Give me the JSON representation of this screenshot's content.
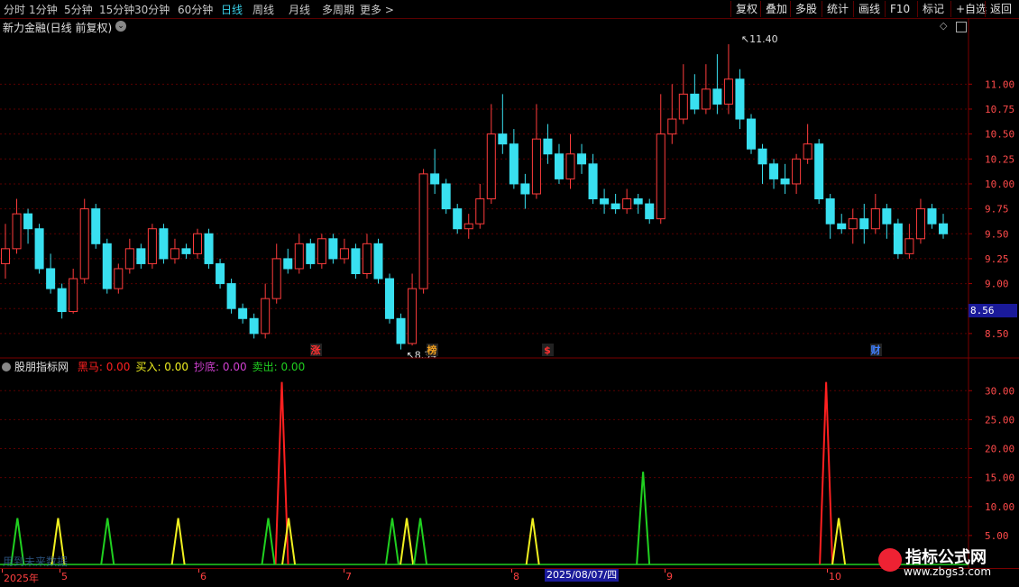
{
  "toolbar": {
    "periods": [
      "分时",
      "1分钟",
      "5分钟",
      "15分钟",
      "30分钟",
      "60分钟",
      "日线",
      "周线",
      "月线",
      "多周期",
      "更多 >"
    ],
    "active_period": "日线",
    "tools": [
      "复权",
      "叠加",
      "多股",
      "统计",
      "画线",
      "F10",
      "标记",
      "+自选",
      "返回"
    ]
  },
  "main": {
    "title": "新力金融(日线 前复权)",
    "high_marker": "11.40",
    "low_marker": "8.34",
    "current_price": "8.56",
    "y_ticks": [
      "11.00",
      "10.75",
      "10.50",
      "10.25",
      "10.00",
      "9.75",
      "9.50",
      "9.25",
      "9.00",
      "8.75",
      "8.50"
    ],
    "event_marks": [
      {
        "text": "涨",
        "color": "#ff3030"
      },
      {
        "text": "榜",
        "color": "#f0a020"
      },
      {
        "text": "$",
        "color": "#ff3030"
      },
      {
        "text": "财",
        "color": "#4080ff"
      }
    ],
    "colors": {
      "up": "#ff3c3c",
      "down": "#39e0f0",
      "grid": "#5a0000"
    }
  },
  "indicator": {
    "name": "股朋指标网",
    "items": [
      {
        "label": "黑马:",
        "value": "0.00",
        "color": "#ff2020"
      },
      {
        "label": "买入:",
        "value": "0.00",
        "color": "#f0f020"
      },
      {
        "label": "抄底:",
        "value": "0.00",
        "color": "#d040d0"
      },
      {
        "label": "卖出:",
        "value": "0.00",
        "color": "#20d020"
      }
    ],
    "y_ticks": [
      "30.00",
      "25.00",
      "20.00",
      "15.00",
      "10.00",
      "5.00"
    ],
    "bottom_text": "用到未来数据"
  },
  "xaxis": {
    "labels": [
      "2025年",
      "5",
      "6",
      "7",
      "8",
      "9",
      "10"
    ],
    "cursor_date": "2025/08/07/四"
  },
  "watermark": {
    "line1": "指标公式网",
    "line2": "www.zbgs3.com"
  },
  "chart_data": {
    "type": "candlestick",
    "title": "新力金融(日线 前复权)",
    "ylim": [
      8.3,
      11.5
    ],
    "high": 11.4,
    "low": 8.34,
    "last": 8.56,
    "candles": [
      [
        9.2,
        9.35,
        9.6,
        9.05
      ],
      [
        9.35,
        9.7,
        9.85,
        9.3
      ],
      [
        9.7,
        9.55,
        9.75,
        9.4
      ],
      [
        9.55,
        9.15,
        9.6,
        9.1
      ],
      [
        9.15,
        8.95,
        9.3,
        8.9
      ],
      [
        8.95,
        8.72,
        9.0,
        8.65
      ],
      [
        8.72,
        9.05,
        9.15,
        8.7
      ],
      [
        9.05,
        9.75,
        9.85,
        9.0
      ],
      [
        9.75,
        9.4,
        9.8,
        9.35
      ],
      [
        9.4,
        8.95,
        9.45,
        8.9
      ],
      [
        8.95,
        9.15,
        9.2,
        8.9
      ],
      [
        9.15,
        9.35,
        9.45,
        9.1
      ],
      [
        9.35,
        9.2,
        9.4,
        9.15
      ],
      [
        9.2,
        9.55,
        9.6,
        9.15
      ],
      [
        9.55,
        9.25,
        9.6,
        9.2
      ],
      [
        9.25,
        9.35,
        9.45,
        9.2
      ],
      [
        9.35,
        9.3,
        9.4,
        9.25
      ],
      [
        9.3,
        9.5,
        9.55,
        9.25
      ],
      [
        9.5,
        9.2,
        9.55,
        9.15
      ],
      [
        9.2,
        9.0,
        9.25,
        8.95
      ],
      [
        9.0,
        8.75,
        9.05,
        8.7
      ],
      [
        8.75,
        8.65,
        8.8,
        8.6
      ],
      [
        8.65,
        8.5,
        8.7,
        8.45
      ],
      [
        8.5,
        8.85,
        9.0,
        8.45
      ],
      [
        8.85,
        9.25,
        9.4,
        8.8
      ],
      [
        9.25,
        9.15,
        9.35,
        9.1
      ],
      [
        9.15,
        9.4,
        9.5,
        9.1
      ],
      [
        9.4,
        9.2,
        9.45,
        9.15
      ],
      [
        9.2,
        9.45,
        9.5,
        9.15
      ],
      [
        9.45,
        9.25,
        9.5,
        9.2
      ],
      [
        9.25,
        9.35,
        9.45,
        9.2
      ],
      [
        9.35,
        9.1,
        9.4,
        9.05
      ],
      [
        9.1,
        9.4,
        9.5,
        9.05
      ],
      [
        9.4,
        9.05,
        9.45,
        9.0
      ],
      [
        9.05,
        8.65,
        9.1,
        8.6
      ],
      [
        8.65,
        8.4,
        8.7,
        8.34
      ],
      [
        8.4,
        8.95,
        9.1,
        8.38
      ],
      [
        8.95,
        10.1,
        10.15,
        8.9
      ],
      [
        10.1,
        10.0,
        10.35,
        9.9
      ],
      [
        10.0,
        9.75,
        10.05,
        9.7
      ],
      [
        9.75,
        9.55,
        9.8,
        9.5
      ],
      [
        9.55,
        9.6,
        9.7,
        9.45
      ],
      [
        9.6,
        9.85,
        10.0,
        9.55
      ],
      [
        9.85,
        10.5,
        10.8,
        9.8
      ],
      [
        10.5,
        10.4,
        10.9,
        10.3
      ],
      [
        10.4,
        10.0,
        10.55,
        9.95
      ],
      [
        10.0,
        9.9,
        10.1,
        9.75
      ],
      [
        9.9,
        10.45,
        10.8,
        9.85
      ],
      [
        10.45,
        10.3,
        10.6,
        10.2
      ],
      [
        10.3,
        10.05,
        10.4,
        10.0
      ],
      [
        10.05,
        10.3,
        10.5,
        9.95
      ],
      [
        10.3,
        10.2,
        10.4,
        10.1
      ],
      [
        10.2,
        9.85,
        10.3,
        9.8
      ],
      [
        9.85,
        9.8,
        9.95,
        9.7
      ],
      [
        9.8,
        9.75,
        9.9,
        9.7
      ],
      [
        9.75,
        9.85,
        9.95,
        9.7
      ],
      [
        9.85,
        9.8,
        9.9,
        9.7
      ],
      [
        9.8,
        9.65,
        9.85,
        9.6
      ],
      [
        9.65,
        10.5,
        10.9,
        9.6
      ],
      [
        10.5,
        10.65,
        11.0,
        10.4
      ],
      [
        10.65,
        10.9,
        11.2,
        10.6
      ],
      [
        10.9,
        10.75,
        11.1,
        10.7
      ],
      [
        10.75,
        10.95,
        11.2,
        10.7
      ],
      [
        10.95,
        10.8,
        11.3,
        10.7
      ],
      [
        10.8,
        11.05,
        11.4,
        10.7
      ],
      [
        11.05,
        10.65,
        11.15,
        10.55
      ],
      [
        10.65,
        10.35,
        10.7,
        10.3
      ],
      [
        10.35,
        10.2,
        10.4,
        10.0
      ],
      [
        10.2,
        10.05,
        10.25,
        9.95
      ],
      [
        10.05,
        10.0,
        10.2,
        9.9
      ],
      [
        10.0,
        10.25,
        10.3,
        9.9
      ],
      [
        10.25,
        10.4,
        10.6,
        10.2
      ],
      [
        10.4,
        9.85,
        10.45,
        9.8
      ],
      [
        9.85,
        9.6,
        9.9,
        9.45
      ],
      [
        9.6,
        9.55,
        9.7,
        9.5
      ],
      [
        9.55,
        9.65,
        9.75,
        9.4
      ],
      [
        9.65,
        9.55,
        9.8,
        9.4
      ],
      [
        9.55,
        9.75,
        9.9,
        9.5
      ],
      [
        9.75,
        9.6,
        9.8,
        9.45
      ],
      [
        9.6,
        9.3,
        9.65,
        9.25
      ],
      [
        9.3,
        9.45,
        9.6,
        9.25
      ],
      [
        9.45,
        9.75,
        9.85,
        9.4
      ],
      [
        9.75,
        9.6,
        9.8,
        9.55
      ],
      [
        9.6,
        9.5,
        9.7,
        9.45
      ]
    ],
    "indicator_series": [
      {
        "name": "黑马",
        "color": "#ff2020",
        "spikes": [
          [
            0.291,
            31.5
          ],
          [
            0.853,
            31.5
          ]
        ]
      },
      {
        "name": "买入",
        "color": "#f0f020",
        "spikes": [
          [
            0.06,
            8
          ],
          [
            0.184,
            8
          ],
          [
            0.298,
            8
          ],
          [
            0.42,
            8
          ],
          [
            0.55,
            8
          ],
          [
            0.866,
            8
          ]
        ]
      },
      {
        "name": "卖出",
        "color": "#20d020",
        "spikes": [
          [
            0.018,
            8
          ],
          [
            0.111,
            8
          ],
          [
            0.277,
            8
          ],
          [
            0.405,
            8
          ],
          [
            0.434,
            8
          ],
          [
            0.664,
            16
          ]
        ]
      }
    ],
    "indicator_ylim": [
      0,
      33
    ]
  }
}
